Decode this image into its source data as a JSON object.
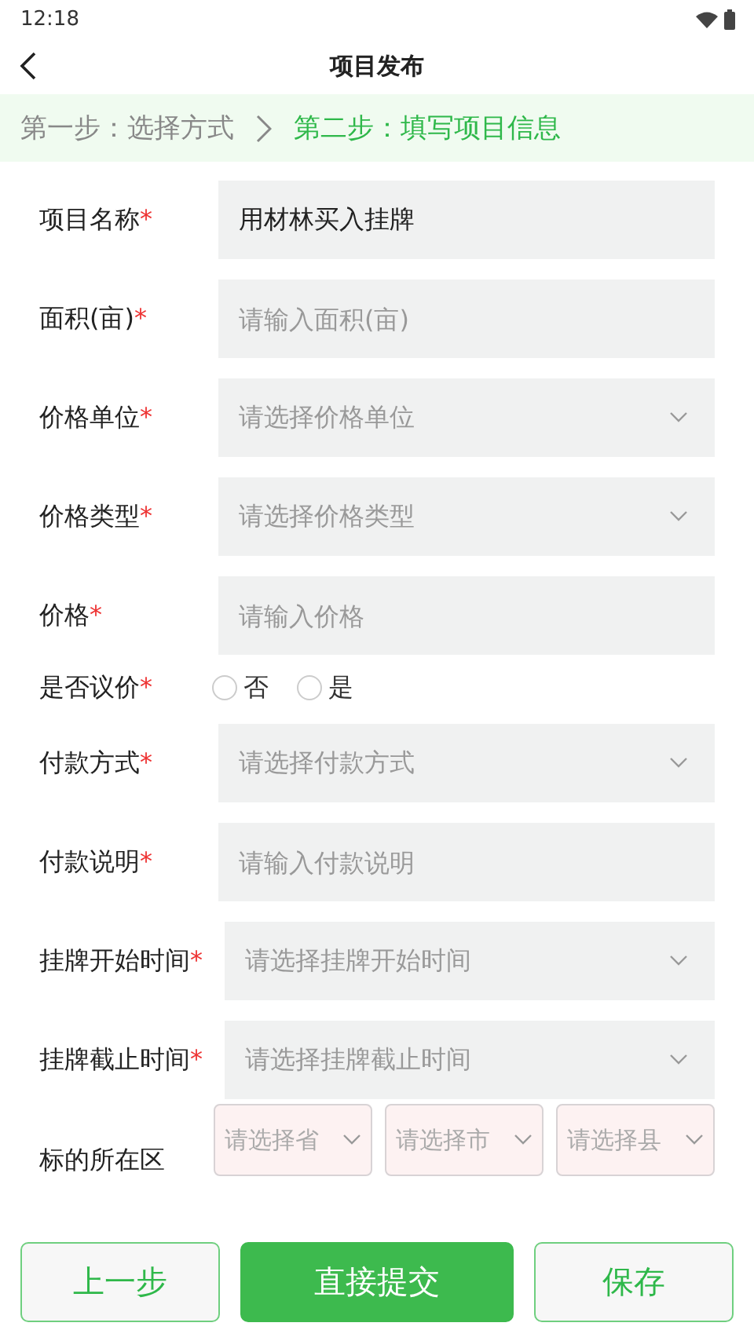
{
  "status_bar": {
    "time": "12:18"
  },
  "header": {
    "title": "项目发布"
  },
  "steps": [
    {
      "label": "第一步：选择方式",
      "selected": false
    },
    {
      "label": "第二步：填写项目信息",
      "selected": true
    }
  ],
  "fields": [
    {
      "kind": "text",
      "label": "项目名称",
      "required_mark": "*",
      "value": "用材林买入挂牌"
    },
    {
      "kind": "text",
      "label": "面积(亩)",
      "required_mark": "*",
      "placeholder": "请输入面积(亩)"
    },
    {
      "kind": "select",
      "label": "价格单位",
      "required_mark": "*",
      "placeholder": "请选择价格单位"
    },
    {
      "kind": "select",
      "label": "价格类型",
      "required_mark": "*",
      "placeholder": "请选择价格类型"
    },
    {
      "kind": "text",
      "label": "价格",
      "required_mark": "*",
      "placeholder": "请输入价格"
    },
    {
      "kind": "radio",
      "label": "是否议价",
      "required_mark": "*",
      "options": [
        {
          "label": "否",
          "selected": false
        },
        {
          "label": "是",
          "selected": false
        }
      ]
    },
    {
      "kind": "select",
      "label": "付款方式",
      "required_mark": "*",
      "placeholder": "请选择付款方式"
    },
    {
      "kind": "text",
      "label": "付款说明",
      "required_mark": "*",
      "placeholder": "请输入付款说明"
    },
    {
      "kind": "select",
      "label": "挂牌开始时间",
      "required_mark": "*",
      "placeholder": "请选择挂牌开始时间"
    },
    {
      "kind": "select",
      "label": "挂牌截止时间",
      "required_mark": "*",
      "placeholder": "请选择挂牌截止时间"
    },
    {
      "kind": "region",
      "label": "标的所在区",
      "selects": [
        {
          "placeholder": "请选择省"
        },
        {
          "placeholder": "请选择市"
        },
        {
          "placeholder": "请选择县"
        }
      ]
    }
  ],
  "buttons": [
    {
      "kind": "secondary",
      "label": "上一步"
    },
    {
      "kind": "primary",
      "label": "直接提交"
    },
    {
      "kind": "secondary",
      "label": "保存"
    }
  ]
}
